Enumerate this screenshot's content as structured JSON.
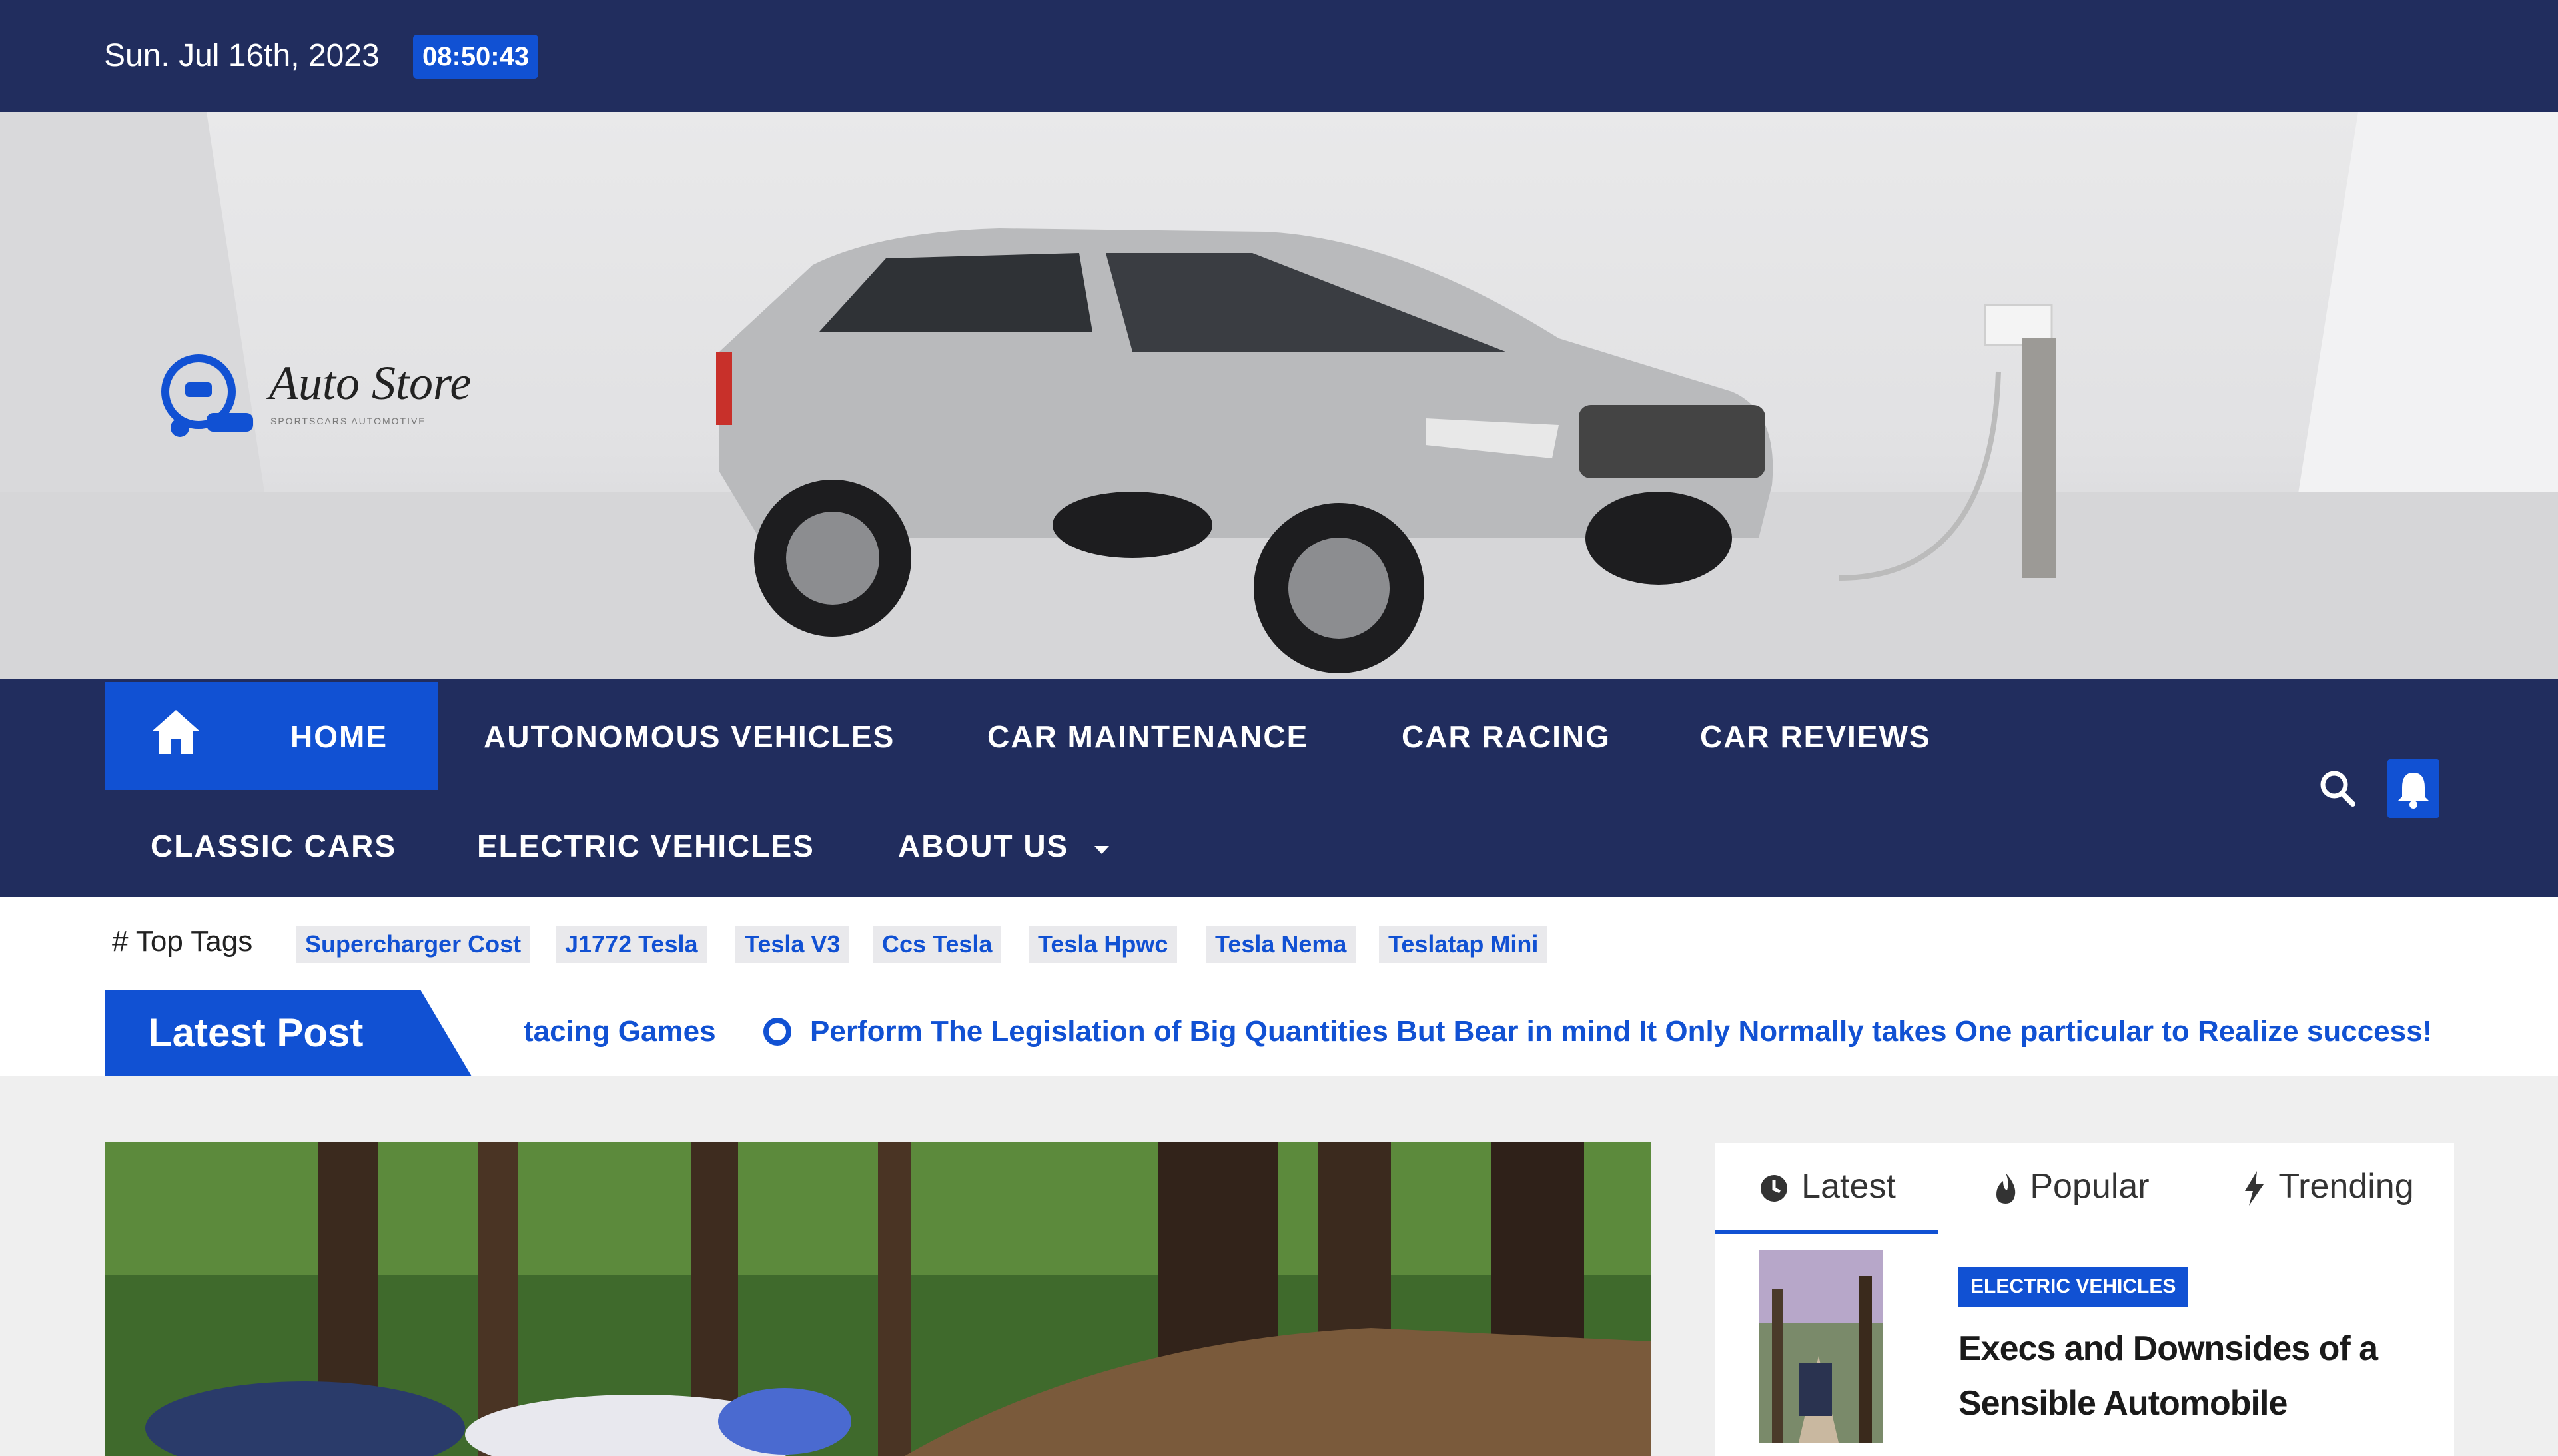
{
  "topbar": {
    "date": "Sun. Jul 16th, 2023",
    "time": "08:50:43"
  },
  "brand": {
    "name": "Auto Store",
    "tagline": "SPORTSCARS AUTOMOTIVE"
  },
  "nav": {
    "home": "HOME",
    "items": [
      "AUTONOMOUS VEHICLES",
      "CAR MAINTENANCE",
      "CAR RACING",
      "CAR REVIEWS",
      "CLASSIC CARS",
      "ELECTRIC VEHICLES",
      "ABOUT US"
    ],
    "icons": {
      "home": "home-icon",
      "search": "search-icon",
      "notification": "bell-icon",
      "dropdown": "caret-down-icon"
    }
  },
  "tags": {
    "label": "Top Tags",
    "items": [
      "Supercharger Cost",
      "J1772 Tesla",
      "Tesla V3",
      "Ccs Tesla",
      "Tesla Hpwc",
      "Tesla Nema",
      "Teslatap Mini"
    ]
  },
  "ticker": {
    "label": "Latest Post",
    "items": [
      "tacing Games",
      "Perform The Legislation of Big Quantities But Bear in mind It Only Normally takes One particular to Realize success!"
    ]
  },
  "sidebar": {
    "tabs": [
      "Latest",
      "Popular",
      "Trending"
    ],
    "active_tab": "Latest",
    "post": {
      "category": "ELECTRIC VEHICLES",
      "title": "Execs and Downsides of a Sensible Automobile"
    }
  },
  "colors": {
    "navy": "#212d5e",
    "accent": "#1151d3",
    "white": "#ffffff"
  }
}
